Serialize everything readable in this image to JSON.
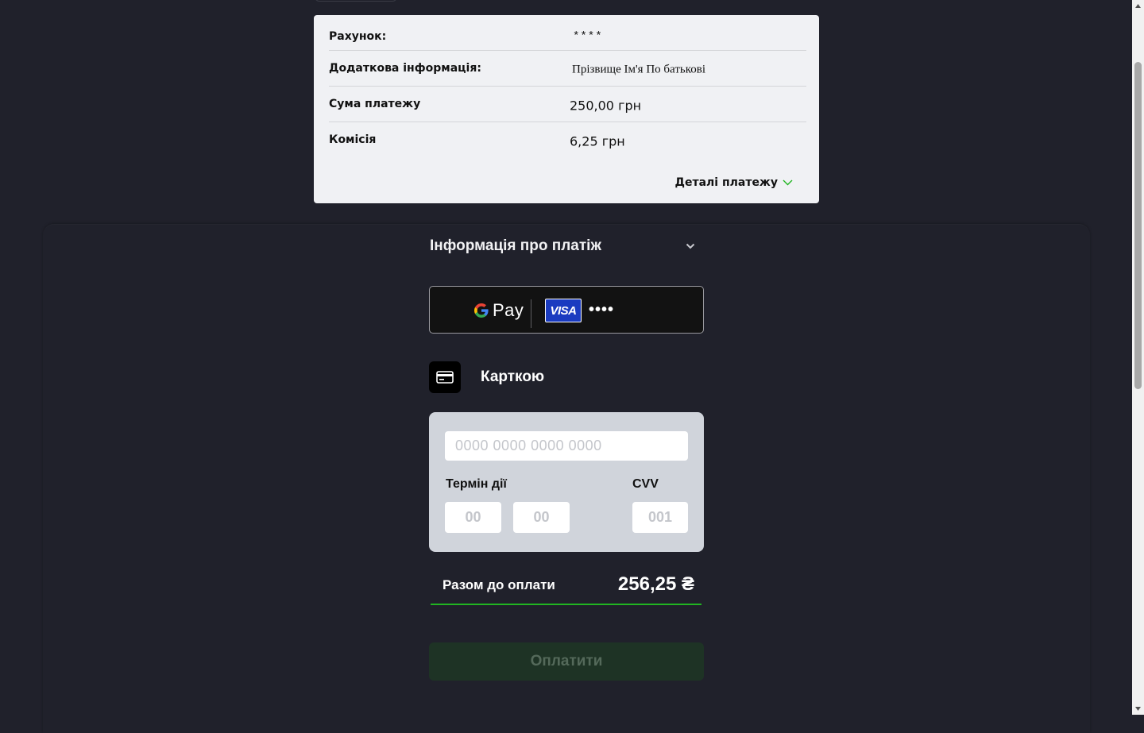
{
  "summary": {
    "rows": [
      {
        "label": "Рахунок:",
        "value": "****"
      },
      {
        "label": "Додаткова інформація:",
        "value": "Прізвище Ім'я По батькові"
      },
      {
        "label": "Сума платежу",
        "value": "250,00 грн"
      },
      {
        "label": "Комісія",
        "value": "6,25 грн"
      }
    ],
    "details_label": "Деталі платежу"
  },
  "payment_info": {
    "title": "Інформація про платіж"
  },
  "gpay_button": {
    "pay_text": "Pay",
    "card_brand": "VISA",
    "card_mask": "••••"
  },
  "card_method": {
    "label": "Карткою"
  },
  "card_form": {
    "card_number_placeholder": "0000 0000 0000 0000",
    "expiry_label": "Термін дії",
    "month_placeholder": "00",
    "year_placeholder": "00",
    "cvv_label": "CVV",
    "cvv_placeholder": "001"
  },
  "total": {
    "label": "Разом до оплати",
    "value": "256,25 ₴"
  },
  "submit": {
    "label": "Оплатити"
  },
  "colors": {
    "background": "#20212b",
    "accent_green": "#21b521",
    "visa_blue": "#1a3bc0",
    "submit_disabled_bg": "#1e3325"
  },
  "icons": [
    "chevron-down-icon",
    "google-g-icon",
    "card-icon"
  ]
}
